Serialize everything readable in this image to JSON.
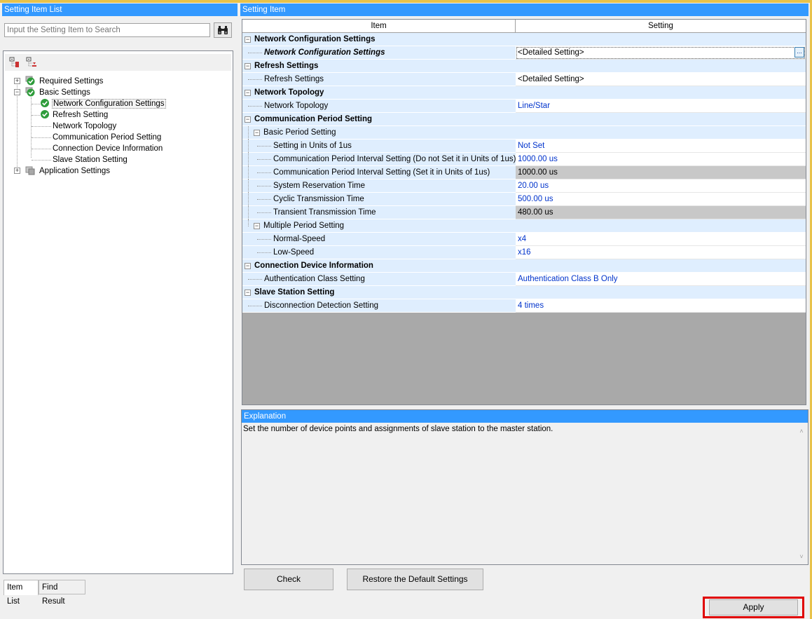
{
  "left_panel": {
    "title": "Setting Item List",
    "search_placeholder": "Input the Setting Item to Search",
    "tree": {
      "required": "Required Settings",
      "basic": "Basic Settings",
      "basic_children": [
        "Network Configuration Settings",
        "Refresh Setting",
        "Network Topology",
        "Communication Period Setting",
        "Connection Device Information",
        "Slave Station Setting"
      ],
      "application": "Application Settings"
    },
    "tabs": [
      "Item List",
      "Find Result"
    ]
  },
  "setting_panel": {
    "title": "Setting Item",
    "columns": {
      "item": "Item",
      "setting": "Setting"
    },
    "rows": [
      {
        "label": "Network Configuration Settings",
        "value": ""
      },
      {
        "label": "Network Configuration Settings",
        "value": "<Detailed Setting>"
      },
      {
        "label": "Refresh Settings",
        "value": ""
      },
      {
        "label": "Refresh Settings",
        "value": "<Detailed Setting>"
      },
      {
        "label": "Network Topology",
        "value": ""
      },
      {
        "label": "Network Topology",
        "value": "Line/Star"
      },
      {
        "label": "Communication Period Setting",
        "value": ""
      },
      {
        "label": "Basic Period Setting",
        "value": ""
      },
      {
        "label": "Setting in Units of 1us",
        "value": "Not Set"
      },
      {
        "label": "Communication Period Interval Setting (Do not Set it in Units of 1us)",
        "value": "1000.00 us"
      },
      {
        "label": "Communication Period Interval Setting (Set it in Units of 1us)",
        "value": "1000.00 us"
      },
      {
        "label": "System Reservation Time",
        "value": "20.00 us"
      },
      {
        "label": "Cyclic Transmission Time",
        "value": "500.00 us"
      },
      {
        "label": "Transient Transmission Time",
        "value": "480.00 us"
      },
      {
        "label": "Multiple Period Setting",
        "value": ""
      },
      {
        "label": "Normal-Speed",
        "value": "x4"
      },
      {
        "label": "Low-Speed",
        "value": "x16"
      },
      {
        "label": "Connection Device Information",
        "value": ""
      },
      {
        "label": "Authentication Class Setting",
        "value": "Authentication Class B Only"
      },
      {
        "label": "Slave Station Setting",
        "value": ""
      },
      {
        "label": "Disconnection Detection Setting",
        "value": "4 times"
      }
    ],
    "ellipsis": "..."
  },
  "explanation": {
    "title": "Explanation",
    "text": "Set the number of device points and assignments of slave station to the master station."
  },
  "buttons": {
    "check": "Check",
    "restore": "Restore the Default Settings",
    "apply": "Apply"
  },
  "colors": {
    "title_bar": "#3399ff",
    "category_row": "#dfeefe",
    "value_text": "#0033cc",
    "highlight": "#e00000"
  }
}
